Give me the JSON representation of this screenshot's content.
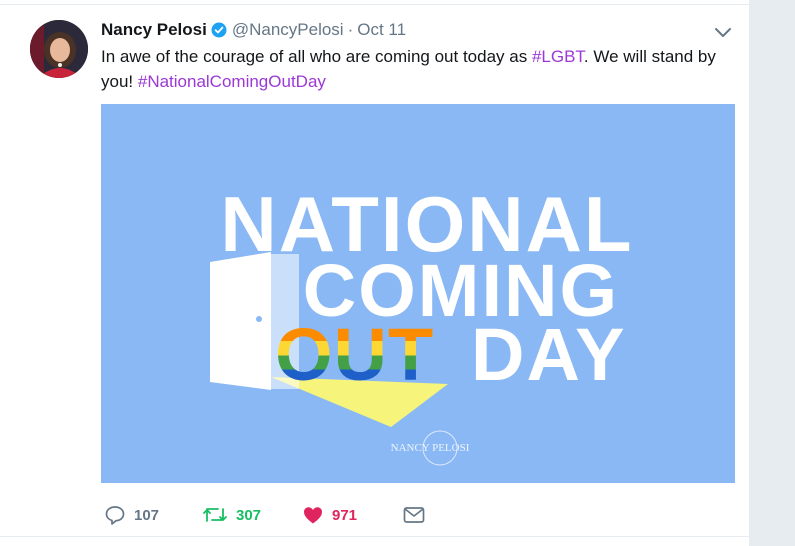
{
  "tweet": {
    "author_name": "Nancy Pelosi",
    "author_handle": "@NancyPelosi",
    "separator": "·",
    "time": "Oct 11",
    "text_part1": "In awe of the courage of all who are coming out today as ",
    "hashtag1": "#LGBT",
    "text_part2": ". We will stand by you! ",
    "hashtag2": "#NationalComingOutDay"
  },
  "media": {
    "line1": "NATIONAL",
    "line2": "COMING",
    "line3_rainbow": "OUT",
    "line3": "DAY",
    "watermark": "NANCY PELOSI",
    "background_color": "#8ab8f4"
  },
  "actions": {
    "reply_count": "107",
    "retweet_count": "307",
    "like_count": "971"
  },
  "colors": {
    "hashtag": "#9b38d6",
    "retweet": "#17bf63",
    "like": "#e0245e",
    "muted": "#657786",
    "verified": "#1da1f2"
  },
  "icons": [
    "verified-badge-icon",
    "chevron-down-icon",
    "reply-icon",
    "retweet-icon",
    "heart-icon",
    "direct-message-icon"
  ]
}
